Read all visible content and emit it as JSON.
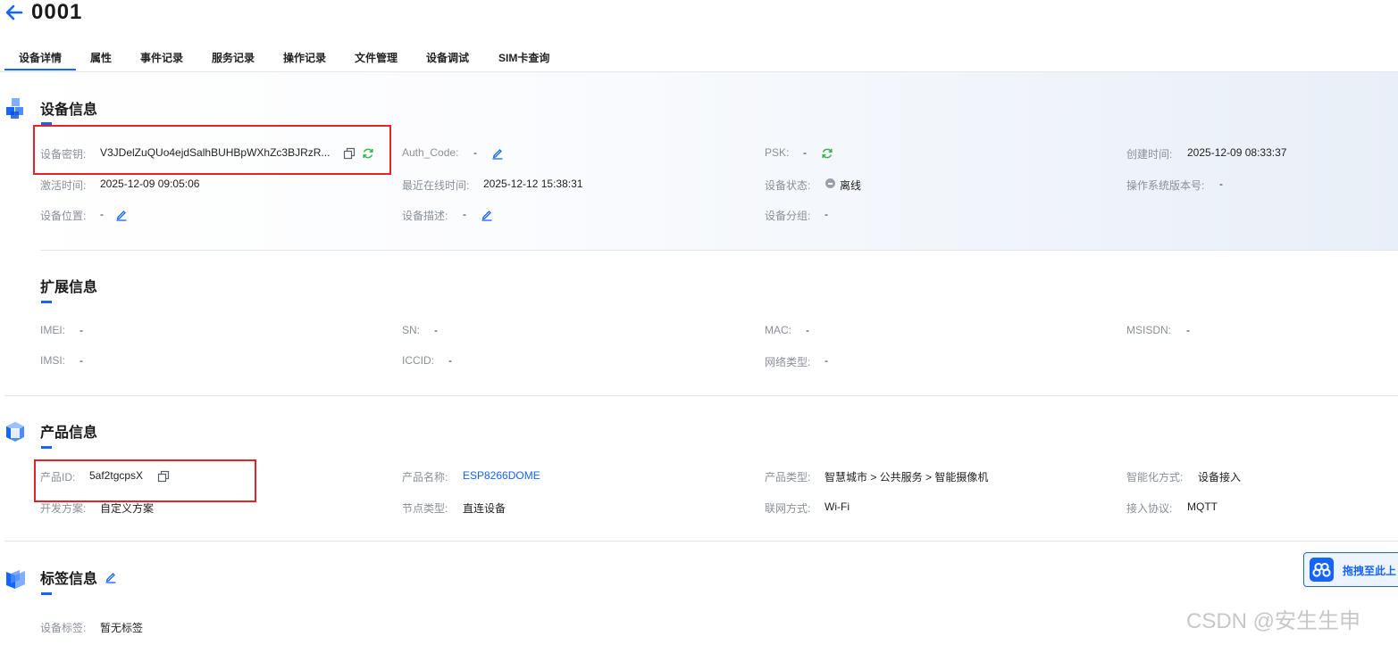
{
  "header": {
    "title": "0001",
    "back_icon": "back-arrow-icon"
  },
  "tabs": [
    {
      "label": "设备详情",
      "active": true
    },
    {
      "label": "属性"
    },
    {
      "label": "事件记录"
    },
    {
      "label": "服务记录"
    },
    {
      "label": "操作记录"
    },
    {
      "label": "文件管理"
    },
    {
      "label": "设备调试"
    },
    {
      "label": "SIM卡查询"
    }
  ],
  "device_info": {
    "title": "设备信息",
    "fields": {
      "secret_label": "设备密钥:",
      "secret_value": "V3JDelZuQUo4ejdSalhBUHBpWXhZc3BJRzR...",
      "auth_label": "Auth_Code:",
      "auth_value": "-",
      "psk_label": "PSK:",
      "psk_value": "-",
      "created_label": "创建时间:",
      "created_value": "2025-12-09 08:33:37",
      "activated_label": "激活时间:",
      "activated_value": "2025-12-09 09:05:06",
      "last_online_label": "最近在线时间:",
      "last_online_value": "2025-12-12 15:38:31",
      "status_label": "设备状态:",
      "status_value": "离线",
      "os_label": "操作系统版本号:",
      "os_value": "-",
      "location_label": "设备位置:",
      "location_value": "-",
      "desc_label": "设备描述:",
      "desc_value": "-",
      "group_label": "设备分组:",
      "group_value": "-"
    }
  },
  "ext_info": {
    "title": "扩展信息",
    "fields": {
      "imei_label": "IMEI:",
      "imei_value": "-",
      "sn_label": "SN:",
      "sn_value": "-",
      "mac_label": "MAC:",
      "mac_value": "-",
      "msisdn_label": "MSISDN:",
      "msisdn_value": "-",
      "imsi_label": "IMSI:",
      "imsi_value": "-",
      "iccid_label": "ICCID:",
      "iccid_value": "-",
      "network_label": "网络类型:",
      "network_value": "-"
    }
  },
  "product_info": {
    "title": "产品信息",
    "fields": {
      "pid_label": "产品ID:",
      "pid_value": "5af2tgcpsX",
      "name_label": "产品名称:",
      "name_value": "ESP8266DOME",
      "type_label": "产品类型:",
      "type_value": "智慧城市 > 公共服务 > 智能摄像机",
      "smart_label": "智能化方式:",
      "smart_value": "设备接入",
      "dev_label": "开发方案:",
      "dev_value": "自定义方案",
      "node_label": "节点类型:",
      "node_value": "直连设备",
      "net_label": "联网方式:",
      "net_value": "Wi-Fi",
      "protocol_label": "接入协议:",
      "protocol_value": "MQTT"
    }
  },
  "tag_info": {
    "title": "标签信息",
    "tag_label": "设备标签:",
    "tag_value": "暂无标签"
  },
  "float_button": {
    "label": "拖拽至此上"
  },
  "watermark": "CSDN @安生生申",
  "colors": {
    "accent": "#1664ff",
    "highlight_box": "#e2232a",
    "refresh": "#3bb54a",
    "label": "#8a8f99"
  }
}
